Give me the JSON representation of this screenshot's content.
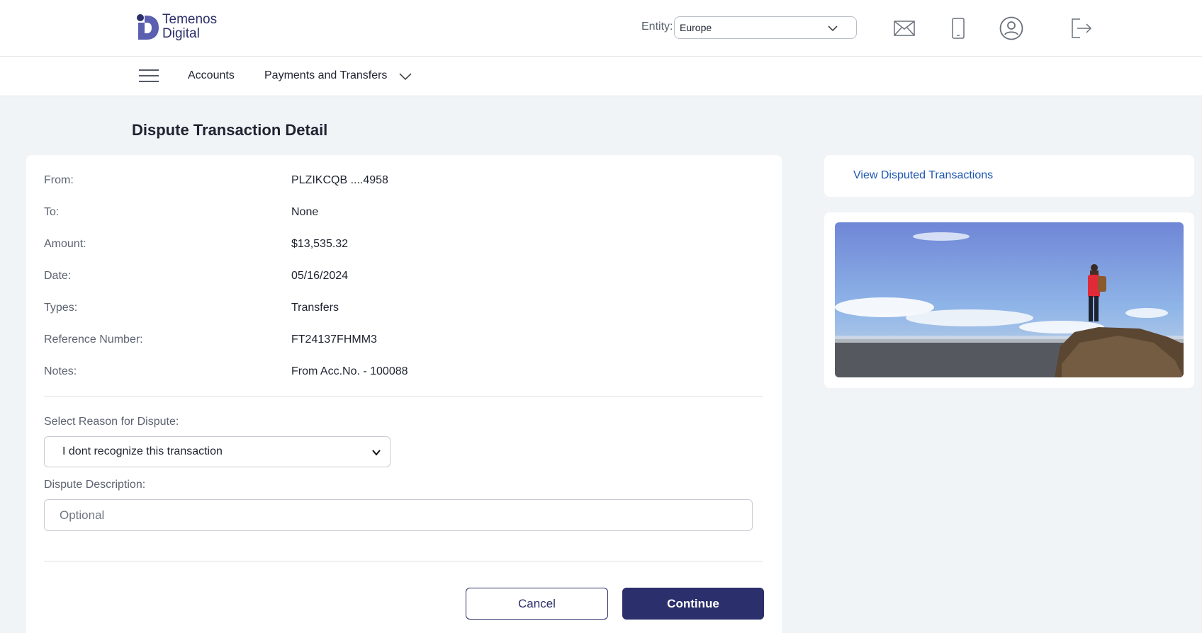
{
  "header": {
    "logo_line1": "Temenos",
    "logo_line2": "Digital",
    "entity_label": "Entity:",
    "entity_value": "Europe",
    "icons": [
      "mail-icon",
      "mobile-icon",
      "profile-icon",
      "logout-icon"
    ]
  },
  "nav": {
    "items": [
      {
        "label": "Accounts"
      },
      {
        "label": "Payments and Transfers"
      }
    ]
  },
  "page": {
    "title": "Dispute Transaction Detail"
  },
  "details": [
    {
      "label": "From:",
      "value": "PLZIKCQB ....4958"
    },
    {
      "label": "To:",
      "value": "None"
    },
    {
      "label": "Amount:",
      "value": "$13,535.32"
    },
    {
      "label": "Date:",
      "value": "05/16/2024"
    },
    {
      "label": "Types:",
      "value": "Transfers"
    },
    {
      "label": "Reference Number:",
      "value": "FT24137FHMM3"
    },
    {
      "label": "Notes:",
      "value": "From Acc.No. - 100088"
    }
  ],
  "form": {
    "reason_label": "Select Reason for Dispute:",
    "reason_value": "I dont recognize this transaction",
    "description_label": "Dispute Description:",
    "description_placeholder": "Optional",
    "description_value": ""
  },
  "actions": {
    "cancel_label": "Cancel",
    "continue_label": "Continue"
  },
  "sidebar": {
    "link_label": "View Disputed Transactions"
  },
  "colors": {
    "brand": "#2b2f6b",
    "link": "#1d56b0",
    "page_bg": "#f1f4f7"
  }
}
